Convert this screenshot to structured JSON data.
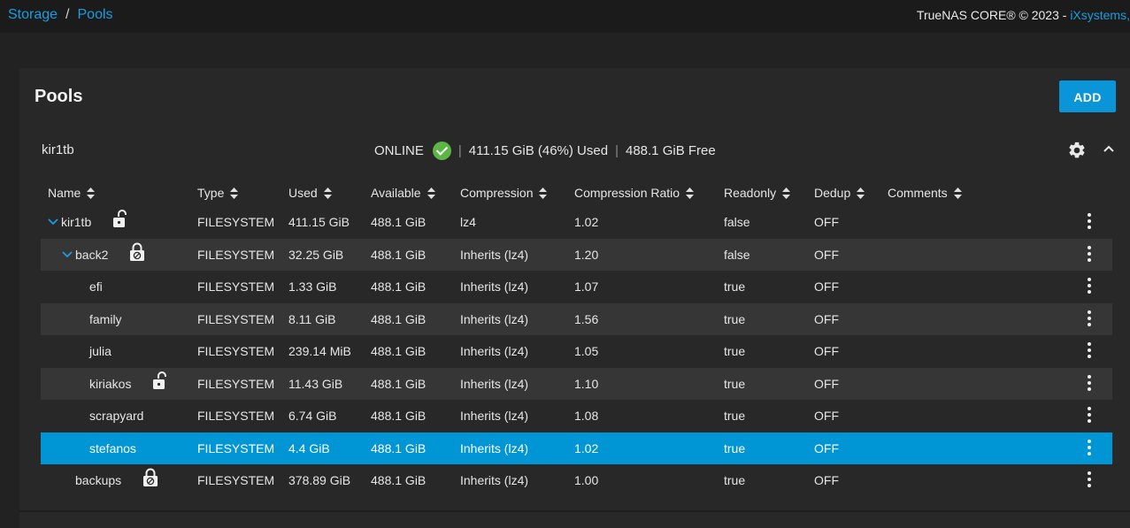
{
  "breadcrumb": {
    "storage": "Storage",
    "separator": "/",
    "pools": "Pools"
  },
  "copyright": {
    "text": "TrueNAS CORE® © 2023 - ",
    "company": "iXsystems,"
  },
  "panel": {
    "title": "Pools",
    "add_label": "ADD"
  },
  "pool": {
    "name": "kir1tb",
    "status": "ONLINE",
    "used": "411.15 GiB (46%) Used",
    "free": "488.1 GiB Free",
    "separator": "|"
  },
  "columns": [
    "Name",
    "Type",
    "Used",
    "Available",
    "Compression",
    "Compression Ratio",
    "Readonly",
    "Dedup",
    "Comments"
  ],
  "rows": [
    {
      "name": "kir1tb",
      "type": "FILESYSTEM",
      "used": "411.15 GiB",
      "available": "488.1 GiB",
      "compression": "lz4",
      "ratio": "1.02",
      "readonly": "false",
      "dedup": "OFF",
      "comments": "",
      "lock": "unlocked",
      "expand": true
    },
    {
      "name": "back2",
      "type": "FILESYSTEM",
      "used": "32.25 GiB",
      "available": "488.1 GiB",
      "compression": "Inherits (lz4)",
      "ratio": "1.20",
      "readonly": "false",
      "dedup": "OFF",
      "comments": "",
      "lock": "not-encrypted",
      "expand": true
    },
    {
      "name": "efi",
      "type": "FILESYSTEM",
      "used": "1.33 GiB",
      "available": "488.1 GiB",
      "compression": "Inherits (lz4)",
      "ratio": "1.07",
      "readonly": "true",
      "dedup": "OFF",
      "comments": "",
      "lock": "none",
      "expand": false
    },
    {
      "name": "family",
      "type": "FILESYSTEM",
      "used": "8.11 GiB",
      "available": "488.1 GiB",
      "compression": "Inherits (lz4)",
      "ratio": "1.56",
      "readonly": "true",
      "dedup": "OFF",
      "comments": "",
      "lock": "none",
      "expand": false
    },
    {
      "name": "julia",
      "type": "FILESYSTEM",
      "used": "239.14 MiB",
      "available": "488.1 GiB",
      "compression": "Inherits (lz4)",
      "ratio": "1.05",
      "readonly": "true",
      "dedup": "OFF",
      "comments": "",
      "lock": "none",
      "expand": false
    },
    {
      "name": "kiriakos",
      "type": "FILESYSTEM",
      "used": "11.43 GiB",
      "available": "488.1 GiB",
      "compression": "Inherits (lz4)",
      "ratio": "1.10",
      "readonly": "true",
      "dedup": "OFF",
      "comments": "",
      "lock": "unlocked",
      "expand": false
    },
    {
      "name": "scrapyard",
      "type": "FILESYSTEM",
      "used": "6.74 GiB",
      "available": "488.1 GiB",
      "compression": "Inherits (lz4)",
      "ratio": "1.08",
      "readonly": "true",
      "dedup": "OFF",
      "comments": "",
      "lock": "none",
      "expand": false
    },
    {
      "name": "stefanos",
      "type": "FILESYSTEM",
      "used": "4.4 GiB",
      "available": "488.1 GiB",
      "compression": "Inherits (lz4)",
      "ratio": "1.02",
      "readonly": "true",
      "dedup": "OFF",
      "comments": "",
      "lock": "none",
      "expand": false,
      "selected": true
    },
    {
      "name": "backups",
      "type": "FILESYSTEM",
      "used": "378.89 GiB",
      "available": "488.1 GiB",
      "compression": "Inherits (lz4)",
      "ratio": "1.00",
      "readonly": "true",
      "dedup": "OFF",
      "comments": "",
      "lock": "not-encrypted",
      "expand": false
    }
  ],
  "colors": {
    "accent": "#0b95d9",
    "selected_row": "#0095d5",
    "online": "#5cb544"
  },
  "icons": {
    "status": "check-circle-icon",
    "settings": "gear-icon",
    "collapse": "chevron-up-icon",
    "sort": "sort-icon",
    "expand": "chevron-down-icon",
    "row_actions": "more-vert-icon",
    "lock_open": "lock-open-icon",
    "not_encrypted": "lock-slash-icon"
  }
}
